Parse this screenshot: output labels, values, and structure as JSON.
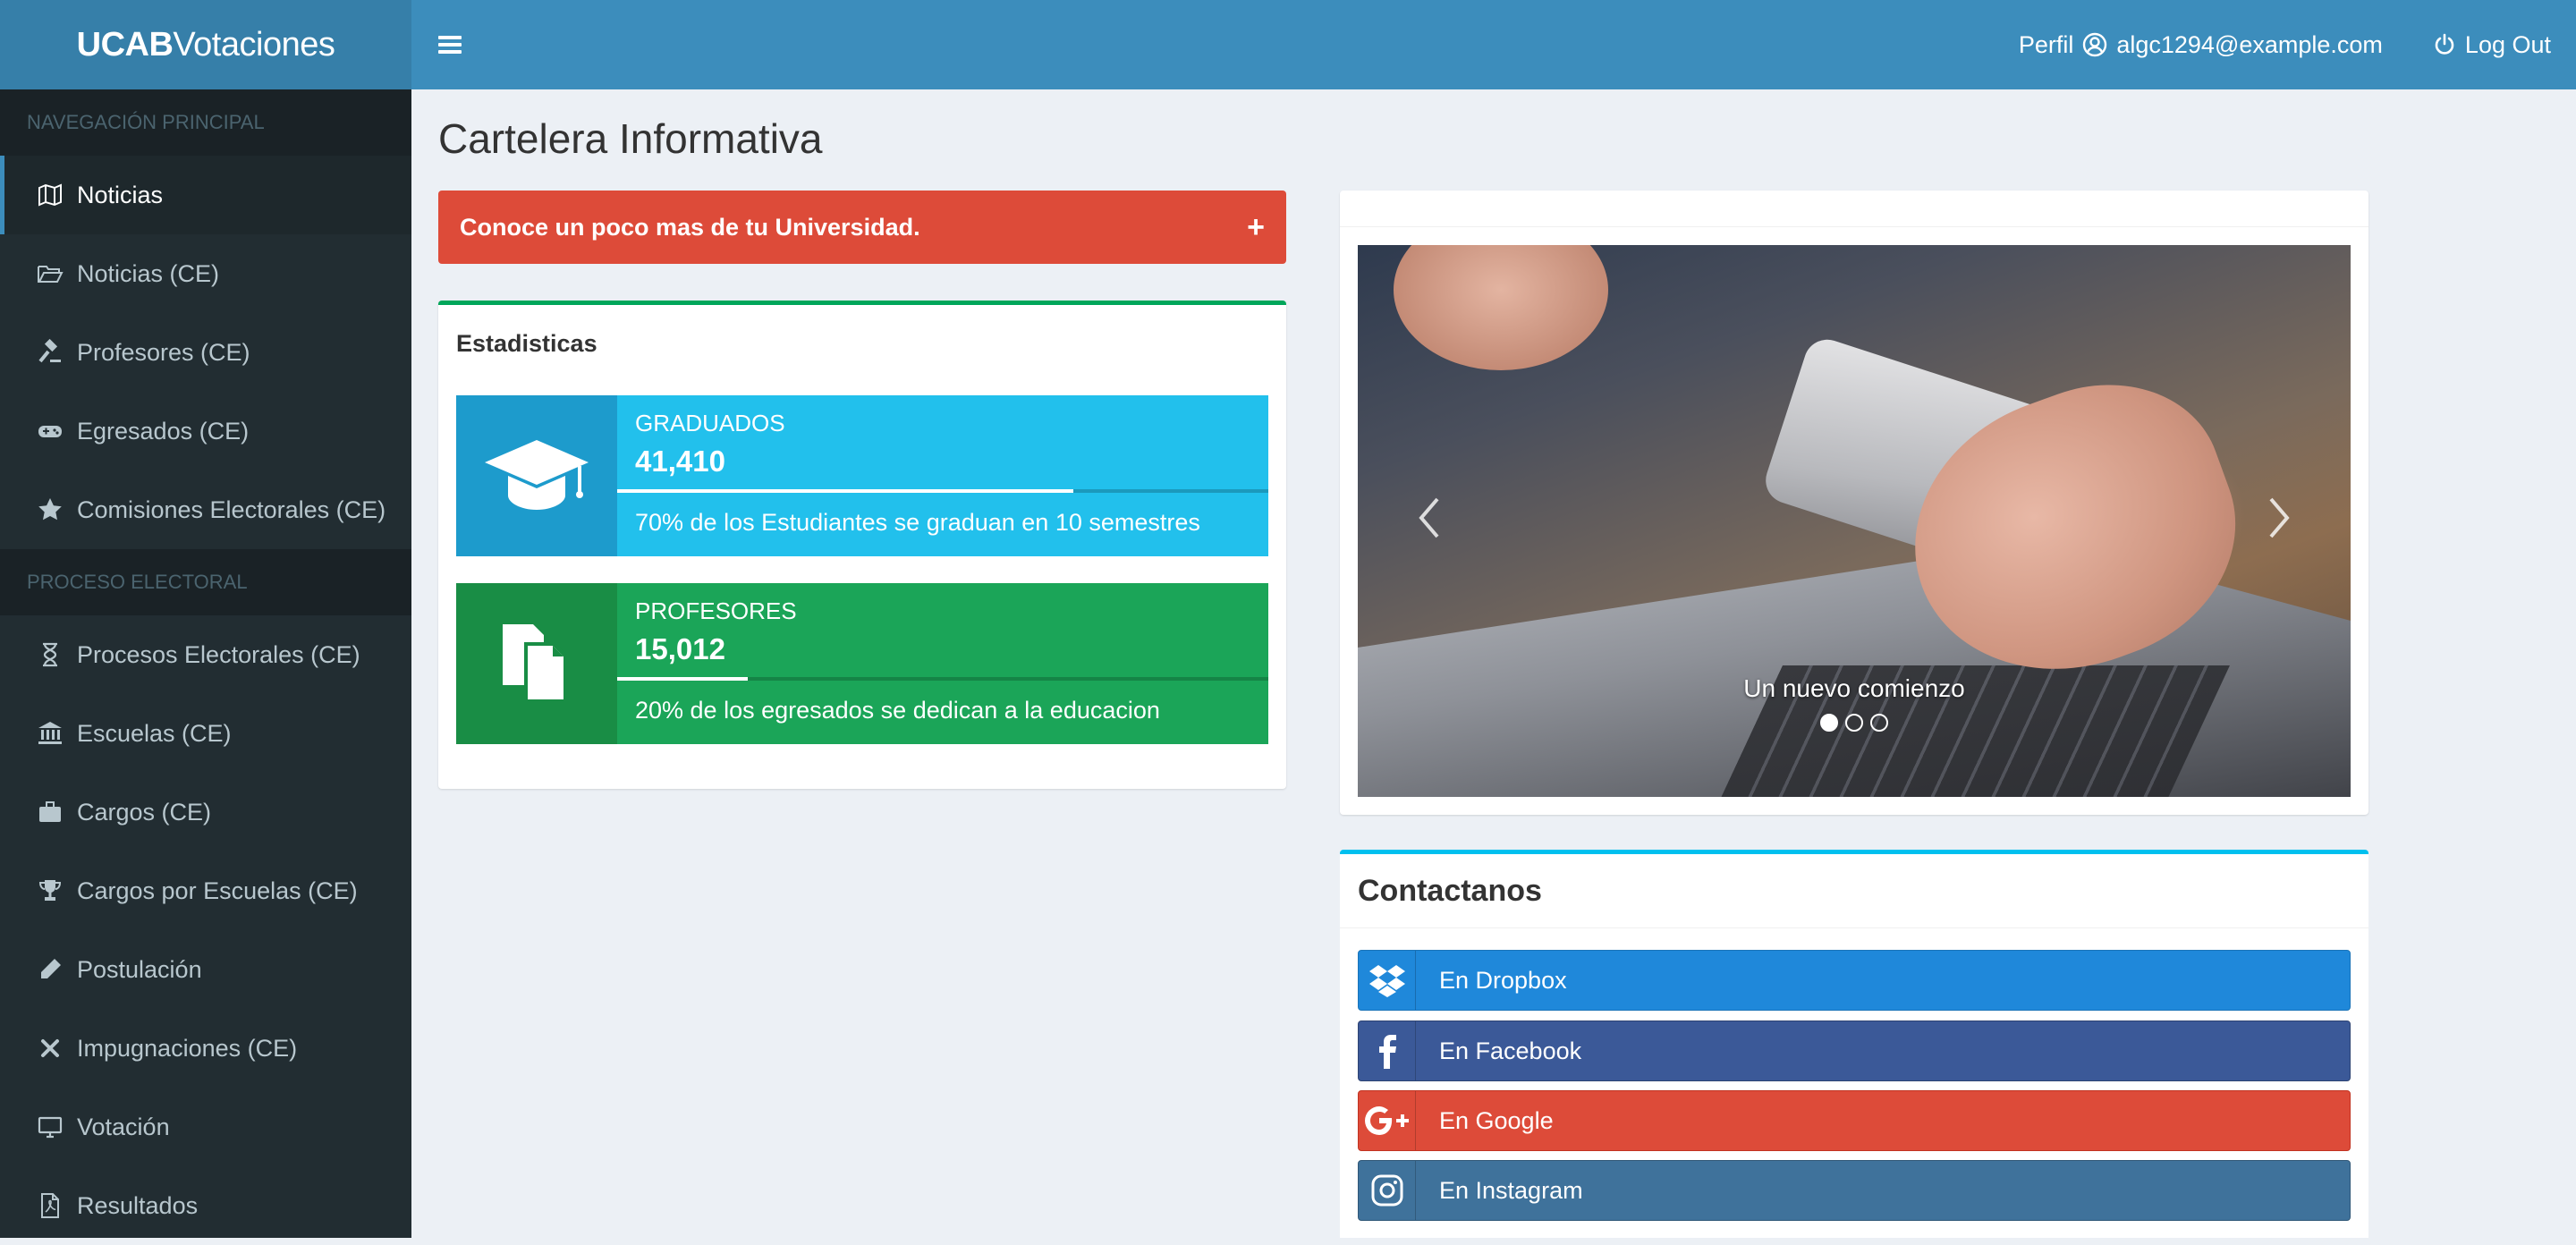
{
  "header": {
    "logo_bold": "UCAB",
    "logo_light": "Votaciones",
    "profile_label": "Perfil",
    "user_email": "algc1294@example.com",
    "logout_label": "Log Out"
  },
  "sidebar": {
    "section1": "Navegación Principal",
    "section2": "Proceso Electoral",
    "items1": [
      {
        "label": "Noticias",
        "icon": "map-icon",
        "active": true
      },
      {
        "label": "Noticias (CE)",
        "icon": "folder-open-icon"
      },
      {
        "label": "Profesores (CE)",
        "icon": "gavel-icon"
      },
      {
        "label": "Egresados (CE)",
        "icon": "gamepad-icon"
      },
      {
        "label": "Comisiones Electorales (CE)",
        "icon": "star-icon"
      }
    ],
    "items2": [
      {
        "label": "Procesos Electorales (CE)",
        "icon": "hourglass-icon"
      },
      {
        "label": "Escuelas (CE)",
        "icon": "bank-icon"
      },
      {
        "label": "Cargos (CE)",
        "icon": "briefcase-icon"
      },
      {
        "label": "Cargos por Escuelas (CE)",
        "icon": "trophy-icon"
      },
      {
        "label": "Postulación",
        "icon": "pencil-icon"
      },
      {
        "label": "Impugnaciones (CE)",
        "icon": "times-icon"
      },
      {
        "label": "Votación",
        "icon": "desktop-icon"
      },
      {
        "label": "Resultados",
        "icon": "file-pdf-icon"
      }
    ]
  },
  "main": {
    "title": "Cartelera Informativa",
    "banner": "Conoce un poco mas de tu Universidad.",
    "banner_plus": "+",
    "stats": {
      "title": "Estadisticas",
      "boxes": [
        {
          "label": "GRADUADOS",
          "number": "41,410",
          "progress": 0.7,
          "desc": "70% de los Estudiantes se graduan en 10 semestres",
          "icon": "graduation-cap-icon"
        },
        {
          "label": "PROFESORES",
          "number": "15,012",
          "progress": 0.2,
          "desc": "20% de los egresados se dedican a la educacion",
          "icon": "files-icon"
        }
      ]
    },
    "carousel": {
      "caption": "Un nuevo comienzo",
      "slides": 3,
      "active_slide": 1
    },
    "contact": {
      "title": "Contactanos",
      "buttons": [
        {
          "label": "En Dropbox",
          "icon": "dropbox-icon",
          "color": "#1f88da"
        },
        {
          "label": "En Facebook",
          "icon": "facebook-icon",
          "color": "#3b5998"
        },
        {
          "label": "En Google",
          "icon": "google-plus-icon",
          "color": "#dd4b39"
        },
        {
          "label": "En Instagram",
          "icon": "instagram-icon",
          "color": "#3f729b"
        }
      ]
    }
  },
  "colors": {
    "header": "#3c8dbc",
    "logo_bg": "#367fa9",
    "sidebar": "#222d32",
    "danger": "#dd4b39",
    "success": "#00a65a",
    "info": "#00c0ef"
  }
}
